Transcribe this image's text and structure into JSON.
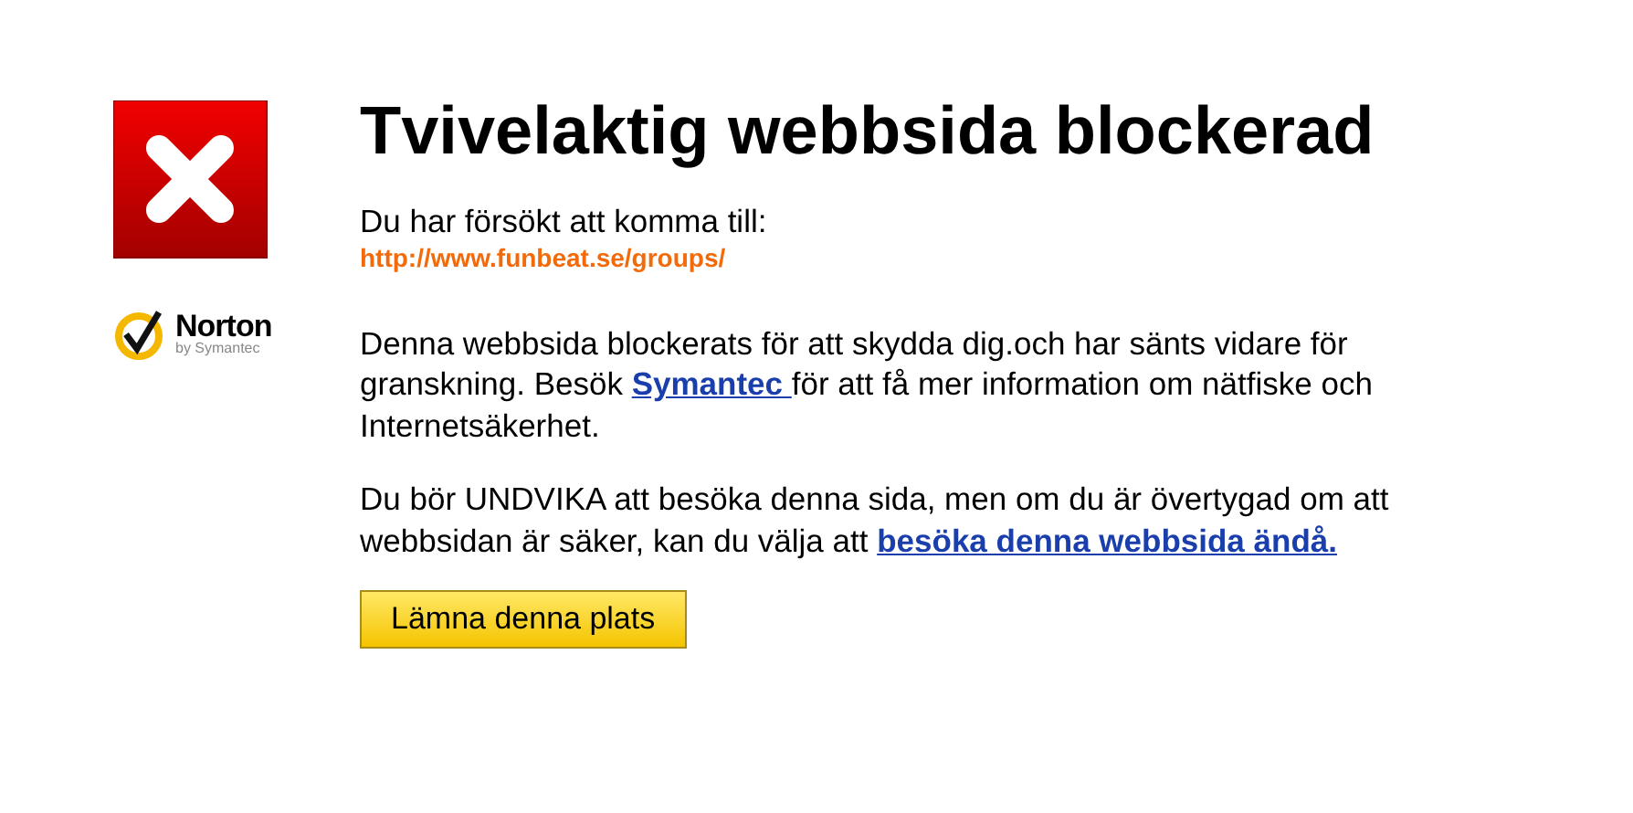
{
  "title": "Tvivelaktig webbsida blockerad",
  "logo": {
    "name": "Norton",
    "byline": "by Symantec"
  },
  "attempt": {
    "label": "Du har försökt att komma till:",
    "url": "http://www.funbeat.se/groups/"
  },
  "paragraphs": [
    {
      "before": "Denna webbsida blockerats för att skydda dig.och har sänts vidare för granskning. Besök ",
      "link": "Symantec ",
      "after": "för att få mer information om nätfiske och Internetsäkerhet."
    },
    {
      "before": "Du bör UNDVIKA att besöka denna sida, men om du är övertygad om att webbsidan är säker, kan du välja att ",
      "link": "besöka denna webbsida ändå."
    }
  ],
  "button": "Lämna denna plats"
}
